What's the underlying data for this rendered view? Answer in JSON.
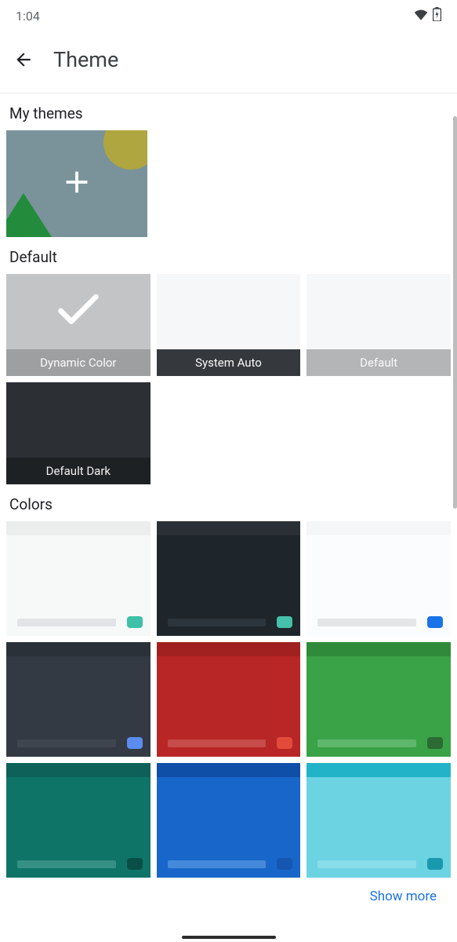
{
  "status": {
    "time": "1:04"
  },
  "header": {
    "title": "Theme"
  },
  "sections": {
    "my_themes": "My themes",
    "default": "Default",
    "colors": "Colors"
  },
  "default_themes": [
    {
      "label": "Dynamic Color",
      "selected": true,
      "top": "#c3c4c5",
      "bottom": "#9e9fa0",
      "text": "#fafafa"
    },
    {
      "label": "System Auto",
      "selected": false,
      "top": "#f6f7f8",
      "bottom": "#35383c",
      "text": "#fafafa"
    },
    {
      "label": "Default",
      "selected": false,
      "top": "#f6f7f8",
      "bottom": "#b4b5b6",
      "text": "#fafafa"
    },
    {
      "label": "Default Dark",
      "selected": false,
      "top": "#2c2f33",
      "bottom": "#1e2124",
      "text": "#f0f0f0"
    }
  ],
  "colors": [
    {
      "top": "#eceeee",
      "body": "#f7f8f8",
      "bar": "#cfd2d3",
      "chip": "#3fc0a8"
    },
    {
      "top": "#2a3036",
      "body": "#1e252b",
      "bar": "#3b444c",
      "chip": "#45c0aa"
    },
    {
      "top": "#f5f6f7",
      "body": "#fbfcfd",
      "bar": "#d2d4d6",
      "chip": "#1a73e8"
    },
    {
      "top": "#2b3139",
      "body": "#343a43",
      "bar": "#4a515a",
      "chip": "#5b8cf0"
    },
    {
      "top": "#a12020",
      "body": "#b92626",
      "bar": "#d46a6a",
      "chip": "#e24a3a"
    },
    {
      "top": "#2f8a3a",
      "body": "#3aa247",
      "bar": "#7ec98a",
      "chip": "#2c6a33"
    },
    {
      "top": "#0d6158",
      "body": "#0f7468",
      "bar": "#5aa89e",
      "chip": "#0a4f47"
    },
    {
      "top": "#0f4fa8",
      "body": "#1866c9",
      "bar": "#6ea6e8",
      "chip": "#1557b0"
    },
    {
      "top": "#22b3c8",
      "body": "#6cd3e2",
      "bar": "#a6e6ef",
      "chip": "#1a98ad"
    }
  ],
  "show_more": "Show more"
}
